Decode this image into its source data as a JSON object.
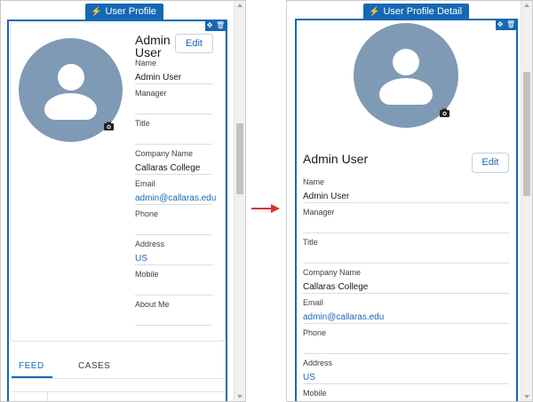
{
  "colors": {
    "accent": "#1668b4",
    "avatar": "#7f9ab4",
    "arrow": "#d9322b"
  },
  "left": {
    "tab_label": "User Profile",
    "tab_icon": "lightning-bolt-icon",
    "name": "Admin User",
    "edit_label": "Edit",
    "fields": [
      {
        "label": "Name",
        "value": "Admin User",
        "link": false
      },
      {
        "label": "Manager",
        "value": "",
        "link": false
      },
      {
        "label": "Title",
        "value": "",
        "link": false
      },
      {
        "label": "Company Name",
        "value": "Callaras College",
        "link": false
      },
      {
        "label": "Email",
        "value": "admin@callaras.edu",
        "link": true
      },
      {
        "label": "Phone",
        "value": "",
        "link": false
      },
      {
        "label": "Address",
        "value": "US",
        "link": true
      },
      {
        "label": "Mobile",
        "value": "",
        "link": false
      },
      {
        "label": "About Me",
        "value": "",
        "link": false
      }
    ],
    "tabs": [
      "FEED",
      "CASES"
    ],
    "active_tab": "FEED"
  },
  "right": {
    "tab_label": "User Profile Detail",
    "tab_icon": "lightning-bolt-icon",
    "name": "Admin User",
    "edit_label": "Edit",
    "fields": [
      {
        "label": "Name",
        "value": "Admin User",
        "link": false
      },
      {
        "label": "Manager",
        "value": "",
        "link": false
      },
      {
        "label": "Title",
        "value": "",
        "link": false
      },
      {
        "label": "Company Name",
        "value": "Callaras College",
        "link": false
      },
      {
        "label": "Email",
        "value": "admin@callaras.edu",
        "link": true
      },
      {
        "label": "Phone",
        "value": "",
        "link": false
      },
      {
        "label": "Address",
        "value": "US",
        "link": true
      },
      {
        "label": "Mobile",
        "value": "",
        "link": false
      }
    ]
  }
}
